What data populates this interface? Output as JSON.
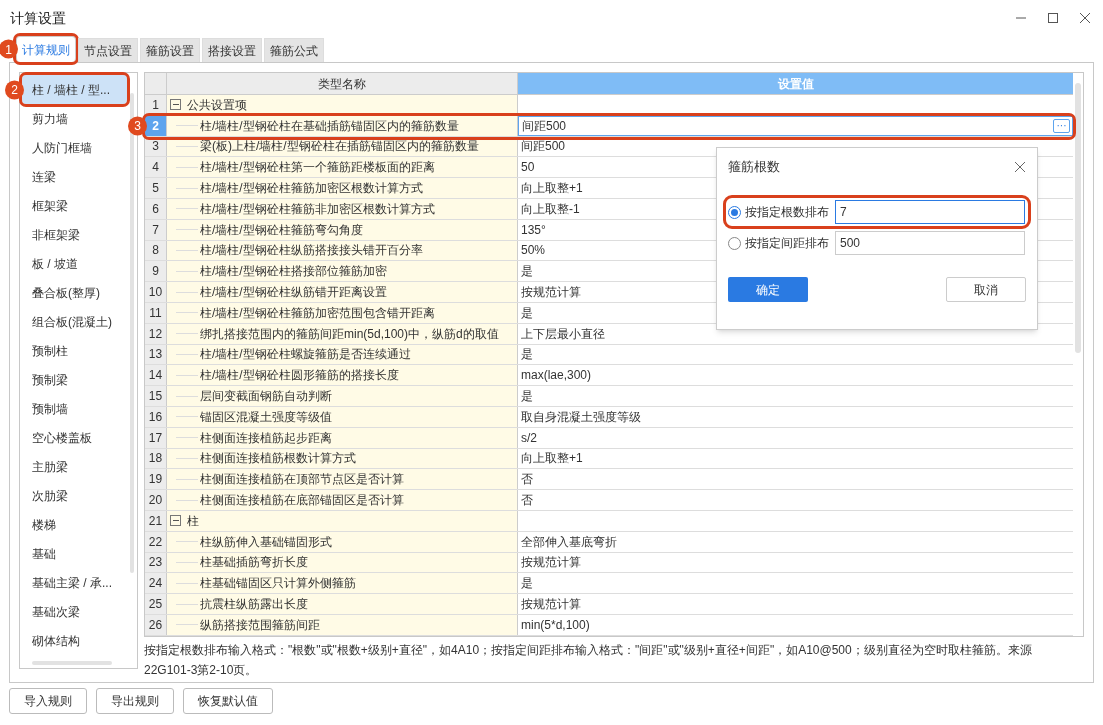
{
  "window": {
    "title": "计算设置"
  },
  "tabs": [
    {
      "label": "计算规则",
      "selected": true,
      "annotation": "1"
    },
    {
      "label": "节点设置",
      "selected": false
    },
    {
      "label": "箍筋设置",
      "selected": false
    },
    {
      "label": "搭接设置",
      "selected": false
    },
    {
      "label": "箍筋公式",
      "selected": false
    }
  ],
  "sidebar": {
    "items": [
      {
        "label": "柱 / 墙柱 / 型...",
        "selected": true,
        "annotation": "2"
      },
      {
        "label": "剪力墙",
        "selected": false
      },
      {
        "label": "人防门框墙",
        "selected": false
      },
      {
        "label": "连梁",
        "selected": false
      },
      {
        "label": "框架梁",
        "selected": false
      },
      {
        "label": "非框架梁",
        "selected": false
      },
      {
        "label": "板 / 坡道",
        "selected": false
      },
      {
        "label": "叠合板(整厚)",
        "selected": false
      },
      {
        "label": "组合板(混凝土)",
        "selected": false
      },
      {
        "label": "预制柱",
        "selected": false
      },
      {
        "label": "预制梁",
        "selected": false
      },
      {
        "label": "预制墙",
        "selected": false
      },
      {
        "label": "空心楼盖板",
        "selected": false
      },
      {
        "label": "主肋梁",
        "selected": false
      },
      {
        "label": "次肋梁",
        "selected": false
      },
      {
        "label": "楼梯",
        "selected": false
      },
      {
        "label": "基础",
        "selected": false
      },
      {
        "label": "基础主梁 / 承...",
        "selected": false
      },
      {
        "label": "基础次梁",
        "selected": false
      },
      {
        "label": "砌体结构",
        "selected": false
      }
    ]
  },
  "table": {
    "columns": [
      "类型名称",
      "设置值"
    ],
    "rows": [
      {
        "no": "1",
        "kind": "group",
        "expanded": true,
        "name": "公共设置项",
        "value": "",
        "selected": false
      },
      {
        "no": "2",
        "kind": "item",
        "name": "柱/墙柱/型钢砼柱在基础插筋锚固区内的箍筋数量",
        "value": "间距500",
        "selected": true,
        "annotation": "3",
        "more": "···"
      },
      {
        "no": "3",
        "kind": "item",
        "name": "梁(板)上柱/墙柱/型钢砼柱在插筋锚固区内的箍筋数量",
        "value": "间距500",
        "selected": false
      },
      {
        "no": "4",
        "kind": "item",
        "name": "柱/墙柱/型钢砼柱第一个箍筋距楼板面的距离",
        "value": "50",
        "selected": false
      },
      {
        "no": "5",
        "kind": "item",
        "name": "柱/墙柱/型钢砼柱箍筋加密区根数计算方式",
        "value": "向上取整+1",
        "selected": false
      },
      {
        "no": "6",
        "kind": "item",
        "name": "柱/墙柱/型钢砼柱箍筋非加密区根数计算方式",
        "value": "向上取整-1",
        "selected": false
      },
      {
        "no": "7",
        "kind": "item",
        "name": "柱/墙柱/型钢砼柱箍筋弯勾角度",
        "value": "135°",
        "selected": false
      },
      {
        "no": "8",
        "kind": "item",
        "name": "柱/墙柱/型钢砼柱纵筋搭接接头错开百分率",
        "value": "50%",
        "selected": false
      },
      {
        "no": "9",
        "kind": "item",
        "name": "柱/墙柱/型钢砼柱搭接部位箍筋加密",
        "value": "是",
        "selected": false
      },
      {
        "no": "10",
        "kind": "item",
        "name": "柱/墙柱/型钢砼柱纵筋错开距离设置",
        "value": "按规范计算",
        "selected": false
      },
      {
        "no": "11",
        "kind": "item",
        "name": "柱/墙柱/型钢砼柱箍筋加密范围包含错开距离",
        "value": "是",
        "selected": false
      },
      {
        "no": "12",
        "kind": "item",
        "name": "绑扎搭接范围内的箍筋间距min(5d,100)中，纵筋d的取值",
        "value": "上下层最小直径",
        "selected": false
      },
      {
        "no": "13",
        "kind": "item",
        "name": "柱/墙柱/型钢砼柱螺旋箍筋是否连续通过",
        "value": "是",
        "selected": false
      },
      {
        "no": "14",
        "kind": "item",
        "name": "柱/墙柱/型钢砼柱圆形箍筋的搭接长度",
        "value": "max(lae,300)",
        "selected": false
      },
      {
        "no": "15",
        "kind": "item",
        "name": "层间变截面钢筋自动判断",
        "value": "是",
        "selected": false
      },
      {
        "no": "16",
        "kind": "item",
        "name": "锚固区混凝土强度等级值",
        "value": "取自身混凝土强度等级",
        "selected": false
      },
      {
        "no": "17",
        "kind": "item",
        "name": "柱侧面连接植筋起步距离",
        "value": "s/2",
        "selected": false
      },
      {
        "no": "18",
        "kind": "item",
        "name": "柱侧面连接植筋根数计算方式",
        "value": "向上取整+1",
        "selected": false
      },
      {
        "no": "19",
        "kind": "item",
        "name": "柱侧面连接植筋在顶部节点区是否计算",
        "value": "否",
        "selected": false
      },
      {
        "no": "20",
        "kind": "item",
        "name": "柱侧面连接植筋在底部锚固区是否计算",
        "value": "否",
        "selected": false
      },
      {
        "no": "21",
        "kind": "group",
        "expanded": true,
        "name": "柱",
        "value": "",
        "selected": false
      },
      {
        "no": "22",
        "kind": "item",
        "name": "柱纵筋伸入基础锚固形式",
        "value": "全部伸入基底弯折",
        "selected": false
      },
      {
        "no": "23",
        "kind": "item",
        "name": "柱基础插筋弯折长度",
        "value": "按规范计算",
        "selected": false
      },
      {
        "no": "24",
        "kind": "item",
        "name": "柱基础锚固区只计算外侧箍筋",
        "value": "是",
        "selected": false
      },
      {
        "no": "25",
        "kind": "item",
        "name": "抗震柱纵筋露出长度",
        "value": "按规范计算",
        "selected": false
      },
      {
        "no": "26",
        "kind": "item",
        "name": "纵筋搭接范围箍筋间距",
        "value": "min(5*d,100)",
        "selected": false
      }
    ]
  },
  "note": "按指定根数排布输入格式：\"根数\"或\"根数+级别+直径\"，如4A10；按指定间距排布输入格式：\"间距\"或\"级别+直径+间距\"，如A10@500；级别直径为空时取柱箍筋。来源22G101-3第2-10页。",
  "dialog": {
    "title": "箍筋根数",
    "options": [
      {
        "label": "按指定根数排布",
        "selected": true,
        "value": "7",
        "highlighted": true
      },
      {
        "label": "按指定间距排布",
        "selected": false,
        "value": "500",
        "highlighted": false
      }
    ],
    "ok": "确定",
    "cancel": "取消"
  },
  "buttons": [
    "导入规则",
    "导出规则",
    "恢复默认值"
  ]
}
